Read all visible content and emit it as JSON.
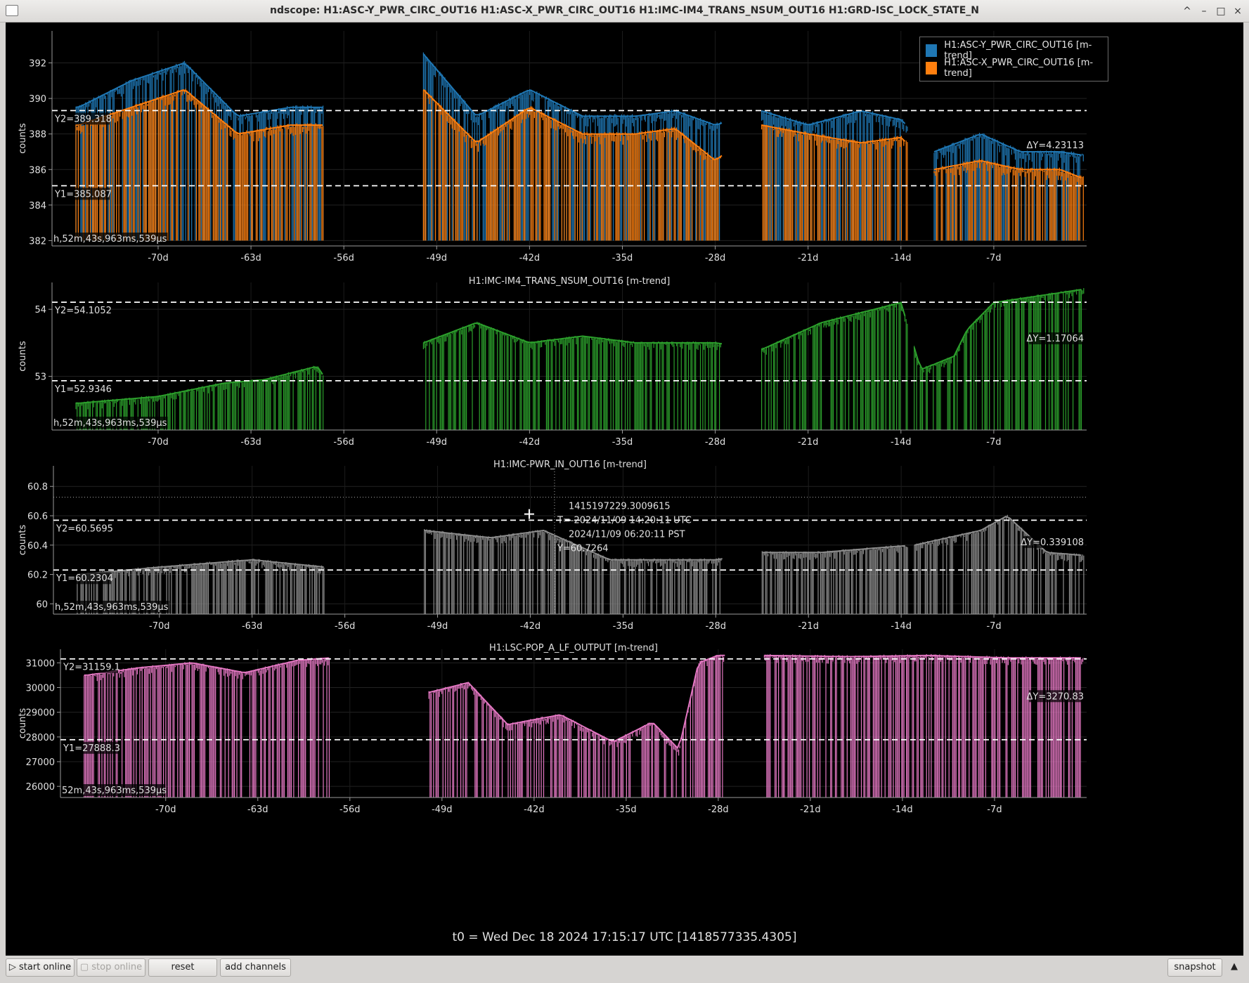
{
  "window": {
    "title": "ndscope: H1:ASC-Y_PWR_CIRC_OUT16 H1:ASC-X_PWR_CIRC_OUT16 H1:IMC-IM4_TRANS_NSUM_OUT16 H1:GRD-ISC_LOCK_STATE_N",
    "controls": [
      "^",
      "–",
      "□",
      "×"
    ]
  },
  "legend": [
    {
      "label": "H1:ASC-Y_PWR_CIRC_OUT16 [m-trend]",
      "color": "#1f77b4"
    },
    {
      "label": "H1:ASC-X_PWR_CIRC_OUT16 [m-trend]",
      "color": "#ff7f0e"
    }
  ],
  "t0_label": "t0 = Wed Dec 18 2024 17:15:17 UTC [1418577335.4305]",
  "toolbar": {
    "start_online": "▷ start online",
    "stop_online": "▢ stop online",
    "reset": "reset",
    "add_channels": "add channels",
    "snapshot": "snapshot",
    "collapse": "▲"
  },
  "chart_data": [
    {
      "type": "line",
      "title": "",
      "ylabel": "counts",
      "x_unit": "days relative to t0",
      "xlim": [
        -78,
        0
      ],
      "xticks": [
        "-70d",
        "-63d",
        "-56d",
        "-49d",
        "-42d",
        "-35d",
        "-28d",
        "-21d",
        "-14d",
        "-7d"
      ],
      "ylim": [
        381.7,
        393.8
      ],
      "yticks": [
        382,
        384,
        386,
        388,
        390,
        392
      ],
      "time_label": "h,52m,43s,963ms,539µs",
      "cursors": {
        "y1": 385.087,
        "y2": 389.318,
        "y1_label": "Y1=385.087",
        "y2_label": "Y2=389.318",
        "dy_label": "ΔY=4.23113"
      },
      "series": [
        {
          "name": "H1:ASC-Y_PWR_CIRC_OUT16 [m-trend]",
          "color": "#1f77b4",
          "segments": [
            [
              -76.2,
              -57.5
            ],
            [
              -50,
              -27.5
            ],
            [
              -24.5,
              -13.5
            ],
            [
              -11.5,
              -0.2
            ]
          ],
          "base": 382,
          "levels": [
            [
              -76,
              389.5
            ],
            [
              -72,
              391
            ],
            [
              -68,
              392
            ],
            [
              -64,
              389
            ],
            [
              -60,
              389.5
            ],
            [
              -57.5,
              389.5
            ],
            [
              -50,
              392.5
            ],
            [
              -46,
              389
            ],
            [
              -42,
              390.5
            ],
            [
              -38,
              389
            ],
            [
              -34,
              389
            ],
            [
              -31,
              389.3
            ],
            [
              -28,
              388.5
            ],
            [
              -24.5,
              389.3
            ],
            [
              -21,
              388.5
            ],
            [
              -17,
              389.3
            ],
            [
              -14,
              388.8
            ],
            [
              -11.5,
              387
            ],
            [
              -8,
              388
            ],
            [
              -5,
              387
            ],
            [
              -2,
              387
            ],
            [
              -0.3,
              386.8
            ]
          ]
        },
        {
          "name": "H1:ASC-X_PWR_CIRC_OUT16 [m-trend]",
          "color": "#ff7f0e",
          "segments": [
            [
              -76.2,
              -57.5
            ],
            [
              -50,
              -27.5
            ],
            [
              -24.5,
              -13.5
            ],
            [
              -11.5,
              -0.2
            ]
          ],
          "base": 382,
          "levels": [
            [
              -76,
              388.5
            ],
            [
              -72,
              389.5
            ],
            [
              -68,
              390.5
            ],
            [
              -64,
              388
            ],
            [
              -60,
              388.5
            ],
            [
              -57.5,
              388.5
            ],
            [
              -50,
              390.5
            ],
            [
              -46,
              387.5
            ],
            [
              -42,
              389.5
            ],
            [
              -38,
              388
            ],
            [
              -34,
              388
            ],
            [
              -31,
              388.3
            ],
            [
              -28,
              386.5
            ],
            [
              -24.5,
              388.5
            ],
            [
              -21,
              388
            ],
            [
              -17,
              387.5
            ],
            [
              -14,
              387.8
            ],
            [
              -11.5,
              386
            ],
            [
              -8,
              386.5
            ],
            [
              -5,
              386
            ],
            [
              -2,
              386
            ],
            [
              -0.3,
              385.5
            ]
          ]
        }
      ]
    },
    {
      "type": "line",
      "title": "H1:IMC-IM4_TRANS_NSUM_OUT16 [m-trend]",
      "ylabel": "counts",
      "x_unit": "days relative to t0",
      "xlim": [
        -78,
        0
      ],
      "xticks": [
        "-70d",
        "-63d",
        "-56d",
        "-49d",
        "-42d",
        "-35d",
        "-28d",
        "-21d",
        "-14d",
        "-7d"
      ],
      "ylim": [
        52.2,
        54.4
      ],
      "yticks": [
        53,
        54
      ],
      "time_label": "h,52m,43s,963ms,539µs",
      "cursors": {
        "y1": 52.9346,
        "y2": 54.1052,
        "y1_label": "Y1=52.9346",
        "y2_label": "Y2=54.1052",
        "dy_label": "ΔY=1.17064"
      },
      "series": [
        {
          "color": "#2ca02c",
          "segments": [
            [
              -76.2,
              -57.5
            ],
            [
              -50,
              -27.5
            ],
            [
              -24.5,
              -13.5
            ],
            [
              -13,
              -0.2
            ]
          ],
          "base": 52.2,
          "levels": [
            [
              -76,
              52.6
            ],
            [
              -70,
              52.7
            ],
            [
              -65,
              52.9
            ],
            [
              -62,
              52.95
            ],
            [
              -58,
              53.15
            ],
            [
              -57.5,
              53.0
            ],
            [
              -50,
              53.5
            ],
            [
              -46,
              53.8
            ],
            [
              -42,
              53.5
            ],
            [
              -38,
              53.6
            ],
            [
              -34,
              53.5
            ],
            [
              -28,
              53.5
            ],
            [
              -24.5,
              53.4
            ],
            [
              -20,
              53.8
            ],
            [
              -16,
              54.0
            ],
            [
              -14,
              54.1
            ],
            [
              -12.5,
              53.1
            ],
            [
              -10,
              53.3
            ],
            [
              -9,
              53.7
            ],
            [
              -7,
              54.1
            ],
            [
              -0.2,
              54.3
            ]
          ]
        }
      ]
    },
    {
      "type": "line",
      "title": "H1:IMC-PWR_IN_OUT16 [m-trend]",
      "ylabel": "counts",
      "x_unit": "days relative to t0",
      "xlim": [
        -78,
        0
      ],
      "xticks": [
        "-70d",
        "-63d",
        "-56d",
        "-49d",
        "-42d",
        "-35d",
        "-28d",
        "-21d",
        "-14d",
        "-7d"
      ],
      "ylim": [
        59.93,
        60.94
      ],
      "yticks": [
        60,
        60.2,
        60.4,
        60.6,
        60.8
      ],
      "time_label": "h,52m,43s,963ms,539µs",
      "cursors": {
        "y1": 60.2304,
        "y2": 60.5695,
        "y1_label": "Y1=60.2304",
        "y2_label": "Y2=60.5695",
        "dy_label": "ΔY=0.339108"
      },
      "crosshair": {
        "y": 60.7264,
        "lines": [
          "1415197229.3009615",
          "T=-2024/11/09 14:20:11 UTC",
          "2024/11/09 06:20:11 PST",
          "Y=60.7264"
        ]
      },
      "series": [
        {
          "color": "#8c8c8c",
          "segments": [
            [
              -76.2,
              -57.5
            ],
            [
              -50,
              -27.5
            ],
            [
              -24.5,
              -13.5
            ],
            [
              -13,
              -0.2
            ]
          ],
          "base": 59.93,
          "levels": [
            [
              -76,
              60.2
            ],
            [
              -70,
              60.25
            ],
            [
              -63,
              60.3
            ],
            [
              -57.5,
              60.25
            ],
            [
              -50,
              60.5
            ],
            [
              -45,
              60.45
            ],
            [
              -41,
              60.5
            ],
            [
              -36,
              60.3
            ],
            [
              -30,
              60.3
            ],
            [
              -28,
              60.3
            ],
            [
              -24.5,
              60.35
            ],
            [
              -20,
              60.35
            ],
            [
              -16,
              60.38
            ],
            [
              -13,
              60.4
            ],
            [
              -8,
              60.5
            ],
            [
              -6,
              60.6
            ],
            [
              -3,
              60.35
            ],
            [
              -0.2,
              60.33
            ]
          ]
        }
      ]
    },
    {
      "type": "line",
      "title": "H1:LSC-POP_A_LF_OUTPUT [m-trend]",
      "ylabel": "counts",
      "x_unit": "days relative to t0",
      "xlim": [
        -78,
        0
      ],
      "xticks": [
        "-70d",
        "-63d",
        "-56d",
        "-49d",
        "-42d",
        "-35d",
        "-28d",
        "-21d",
        "-14d",
        "-7d"
      ],
      "ylim": [
        25550,
        31550
      ],
      "yticks": [
        26000,
        27000,
        28000,
        29000,
        30000,
        31000
      ],
      "time_label": "52m,43s,963ms,539µs",
      "cursors": {
        "y1": 27888.3,
        "y2": 31159.1,
        "y1_label": "Y1=27888.3",
        "y2_label": "Y2=31159.1",
        "dy_label": "ΔY=3270.83"
      },
      "series": [
        {
          "color": "#e377c2",
          "segments": [
            [
              -76.2,
              -57.5
            ],
            [
              -50,
              -27.5
            ],
            [
              -24.5,
              -0.2
            ]
          ],
          "base": 25550,
          "levels": [
            [
              -76,
              30500
            ],
            [
              -72,
              30800
            ],
            [
              -68,
              31000
            ],
            [
              -64,
              30600
            ],
            [
              -60,
              31100
            ],
            [
              -57.5,
              31200
            ],
            [
              -50,
              29800
            ],
            [
              -47,
              30200
            ],
            [
              -44,
              28500
            ],
            [
              -40,
              28900
            ],
            [
              -36,
              27800
            ],
            [
              -33,
              28600
            ],
            [
              -31,
              27500
            ],
            [
              -29.5,
              31000
            ],
            [
              -28,
              31300
            ],
            [
              -24.5,
              31300
            ],
            [
              -18,
              31250
            ],
            [
              -12,
              31300
            ],
            [
              -6,
              31200
            ],
            [
              -0.2,
              31200
            ]
          ]
        }
      ]
    }
  ]
}
